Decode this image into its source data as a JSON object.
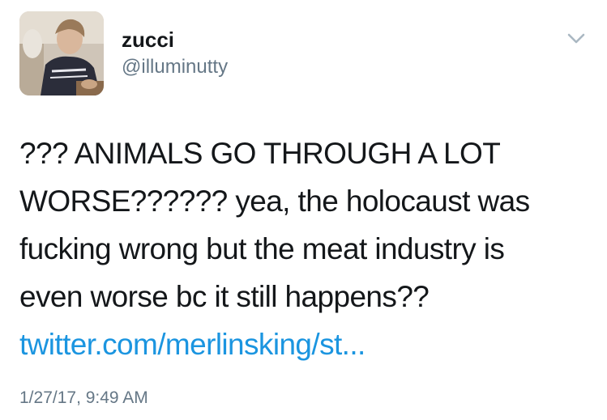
{
  "tweet": {
    "author": {
      "display_name": "zucci",
      "handle": "@illuminutty",
      "avatar_icon": "avatar-photo"
    },
    "menu_icon": "chevron-down-icon",
    "text_lines": [
      "??? ANIMALS GO THROUGH A LOT",
      "WORSE?????? yea, the holocaust was",
      "fucking wrong but the meat industry is",
      "even worse bc it still happens??"
    ],
    "link": "twitter.com/merlinsking/st...",
    "timestamp": "1/27/17, 9:49 AM"
  },
  "colors": {
    "text": "#14171a",
    "secondary": "#657786",
    "link": "#1b95e0",
    "background": "#ffffff"
  }
}
